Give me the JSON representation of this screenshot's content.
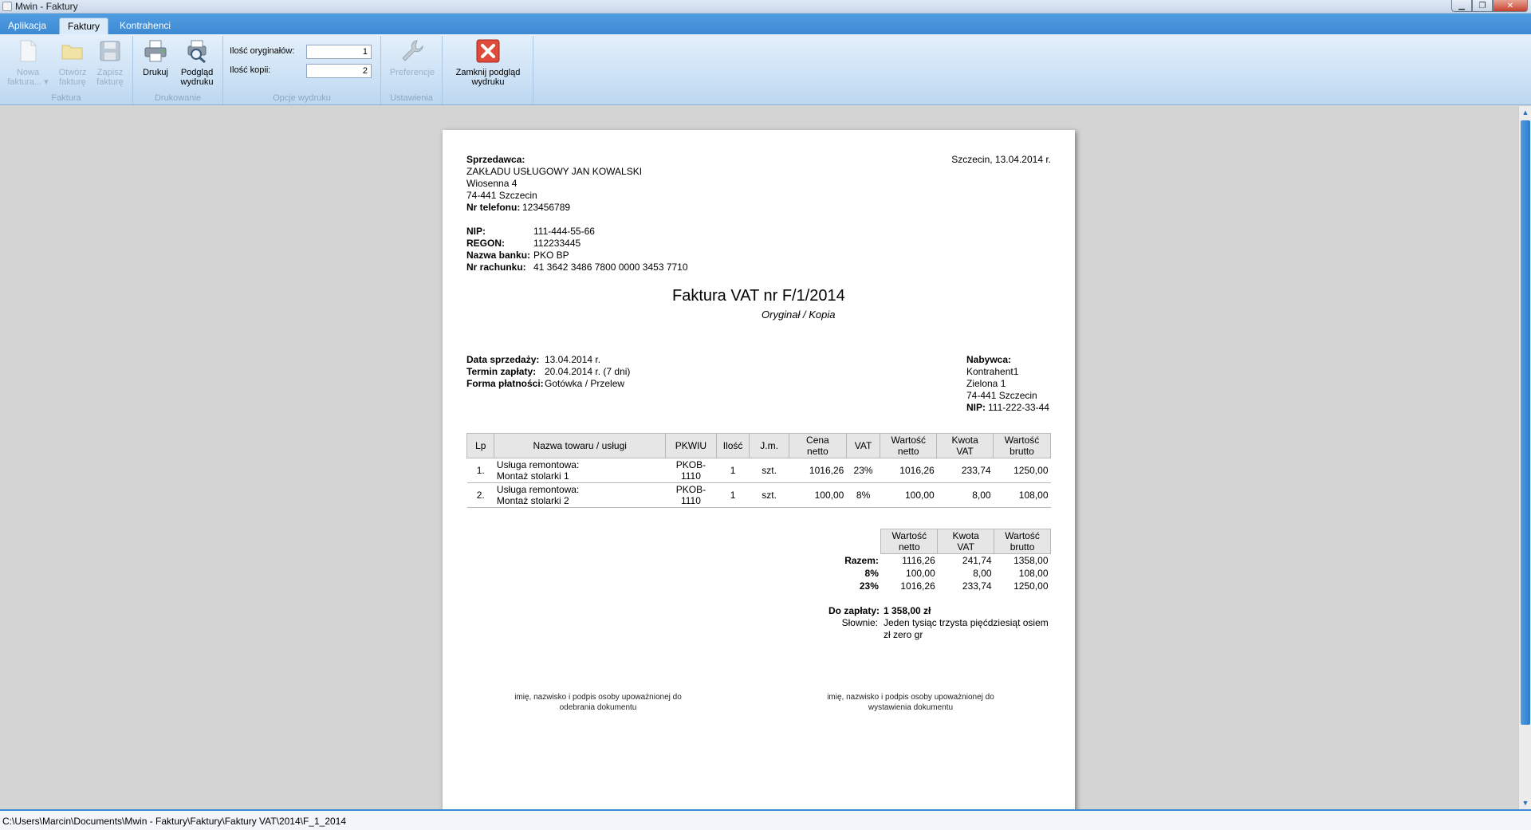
{
  "window": {
    "title": "Mwin - Faktury",
    "min": "▁",
    "max": "❐",
    "close": "✕"
  },
  "tabs": [
    "Aplikacja",
    "Faktury",
    "Kontrahenci"
  ],
  "ribbon": {
    "faktura": {
      "label": "Faktura",
      "new1": "Nowa",
      "new2": "faktura... ▾",
      "open1": "Otwórz",
      "open2": "fakturę",
      "save1": "Zapisz",
      "save2": "fakturę"
    },
    "drukowanie": {
      "label": "Drukowanie",
      "print": "Drukuj",
      "preview1": "Podgląd",
      "preview2": "wydruku"
    },
    "opcje": {
      "label": "Opcje wydruku",
      "originals_label": "Ilość oryginałów:",
      "originals_value": "1",
      "copies_label": "Ilość kopii:",
      "copies_value": "2"
    },
    "ustawienia": {
      "label": "Ustawienia",
      "prefs": "Preferencje"
    },
    "close": {
      "line1": "Zamknij podgląd",
      "line2": "wydruku"
    }
  },
  "invoice": {
    "seller_label": "Sprzedawca:",
    "seller_name": "ZAKŁADU USŁUGOWY JAN KOWALSKI",
    "seller_street": "Wiosenna 4",
    "seller_city": "74-441 Szczecin",
    "phone_label": "Nr telefonu:",
    "phone": "123456789",
    "place_date": "Szczecin, 13.04.2014 r.",
    "nip_label": "NIP:",
    "nip": "111-444-55-66",
    "regon_label": "REGON:",
    "regon": "112233445",
    "bank_label": "Nazwa banku:",
    "bank": "PKO BP",
    "account_label": "Nr rachunku:",
    "account": "41 3642 3486 7800 0000 3453 7710",
    "title": "Faktura VAT nr F/1/2014",
    "subtitle": "Oryginał / Kopia",
    "sale_date_label": "Data sprzedaży:",
    "sale_date": "13.04.2014 r.",
    "due_label": "Termin zapłaty:",
    "due": "20.04.2014 r. (7 dni)",
    "payment_label": "Forma płatności:",
    "payment": "Gotówka / Przelew",
    "buyer_label": "Nabywca:",
    "buyer_name": "Kontrahent1",
    "buyer_street": "Zielona 1",
    "buyer_city": "74-441 Szczecin",
    "buyer_nip_label": "NIP:",
    "buyer_nip": "111-222-33-44",
    "columns": {
      "lp": "Lp",
      "name": "Nazwa towaru / usługi",
      "pkwiu": "PKWIU",
      "qty": "Ilość",
      "unit": "J.m.",
      "price1": "Cena",
      "price2": "netto",
      "vat": "VAT",
      "net1": "Wartość",
      "net2": "netto",
      "vatamt1": "Kwota",
      "vatamt2": "VAT",
      "gross1": "Wartość",
      "gross2": "brutto"
    },
    "items": [
      {
        "lp": "1.",
        "name1": "Usługa remontowa:",
        "name2": "Montaż stolarki 1",
        "pkwiu": "PKOB-1110",
        "qty": "1",
        "unit": "szt.",
        "price": "1016,26",
        "vat": "23%",
        "net": "1016,26",
        "vatamt": "233,74",
        "gross": "1250,00"
      },
      {
        "lp": "2.",
        "name1": "Usługa remontowa:",
        "name2": "Montaż stolarki 2",
        "pkwiu": "PKOB-1110",
        "qty": "1",
        "unit": "szt.",
        "price": "100,00",
        "vat": "8%",
        "net": "100,00",
        "vatamt": "8,00",
        "gross": "108,00"
      }
    ],
    "summary": {
      "rows": [
        {
          "label": "Razem:",
          "net": "1116,26",
          "vat": "241,74",
          "gross": "1358,00"
        },
        {
          "label": "8%",
          "net": "100,00",
          "vat": "8,00",
          "gross": "108,00"
        },
        {
          "label": "23%",
          "net": "1016,26",
          "vat": "233,74",
          "gross": "1250,00"
        }
      ]
    },
    "to_pay_label": "Do zapłaty:",
    "to_pay": "1 358,00 zł",
    "words_label": "Słownie:",
    "words1": "Jeden tysiąc trzysta pięćdziesiąt osiem",
    "words2": "zł zero gr",
    "sig_left1": "imię, nazwisko i podpis osoby upoważnionej do",
    "sig_left2": "odebrania dokumentu",
    "sig_right1": "imię, nazwisko i podpis osoby upoważnionej do",
    "sig_right2": "wystawienia dokumentu"
  },
  "status": {
    "path": "C:\\Users\\Marcin\\Documents\\Mwin - Faktury\\Faktury\\Faktury VAT\\2014\\F_1_2014"
  }
}
